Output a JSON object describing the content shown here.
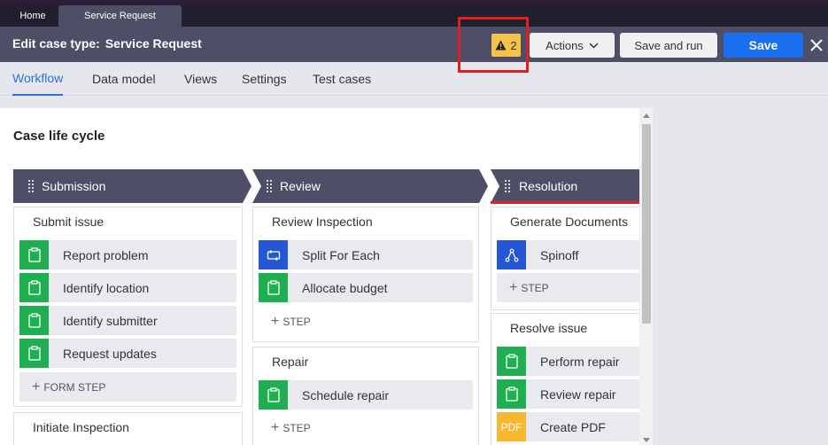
{
  "tabs": [
    {
      "label": "Home"
    },
    {
      "label": "Service Request"
    }
  ],
  "header": {
    "title_label": "Edit case type:",
    "title_value": "Service Request",
    "warning_count": "2",
    "actions_label": "Actions",
    "save_run_label": "Save and run",
    "save_label": "Save"
  },
  "subnav": [
    {
      "label": "Workflow",
      "active": true
    },
    {
      "label": "Data model"
    },
    {
      "label": "Views"
    },
    {
      "label": "Settings"
    },
    {
      "label": "Test cases"
    }
  ],
  "lifecycle": {
    "title": "Case life cycle",
    "stages": [
      {
        "label": "Submission"
      },
      {
        "label": "Review"
      },
      {
        "label": "Resolution"
      }
    ],
    "processes": {
      "submit_issue": {
        "title": "Submit issue",
        "steps": [
          "Report problem",
          "Identify location",
          "Identify submitter",
          "Request updates"
        ],
        "add_label": "FORM STEP"
      },
      "initiate_inspection": {
        "title": "Initiate Inspection"
      },
      "review_inspection": {
        "title": "Review Inspection",
        "steps": [
          "Split For Each",
          "Allocate budget"
        ],
        "add_label": "STEP"
      },
      "repair": {
        "title": "Repair",
        "steps": [
          "Schedule repair"
        ],
        "add_label": "STEP"
      },
      "generate_documents": {
        "title": "Generate Documents",
        "steps": [
          "Spinoff"
        ],
        "add_label": "STEP"
      },
      "resolve_issue": {
        "title": "Resolve issue",
        "steps": [
          "Perform repair",
          "Review repair",
          "Create PDF"
        ],
        "pdf_badge": "PDF"
      }
    }
  },
  "colors": {
    "stage_bg": "#4e4f66",
    "step_green": "#1fae52",
    "step_blue": "#2457d6",
    "save_blue": "#1a6ef0",
    "warning_yellow": "#f5c24a",
    "highlight_red": "#e41d23"
  },
  "icons": {
    "warning": "warning-icon",
    "form_step": "clipboard-icon",
    "split_for_each": "loop-icon",
    "spinoff": "branch-icon",
    "pdf": "pdf-icon",
    "close": "close-icon",
    "chevron": "chevron-down-icon",
    "drag": "drag-handle-icon"
  }
}
